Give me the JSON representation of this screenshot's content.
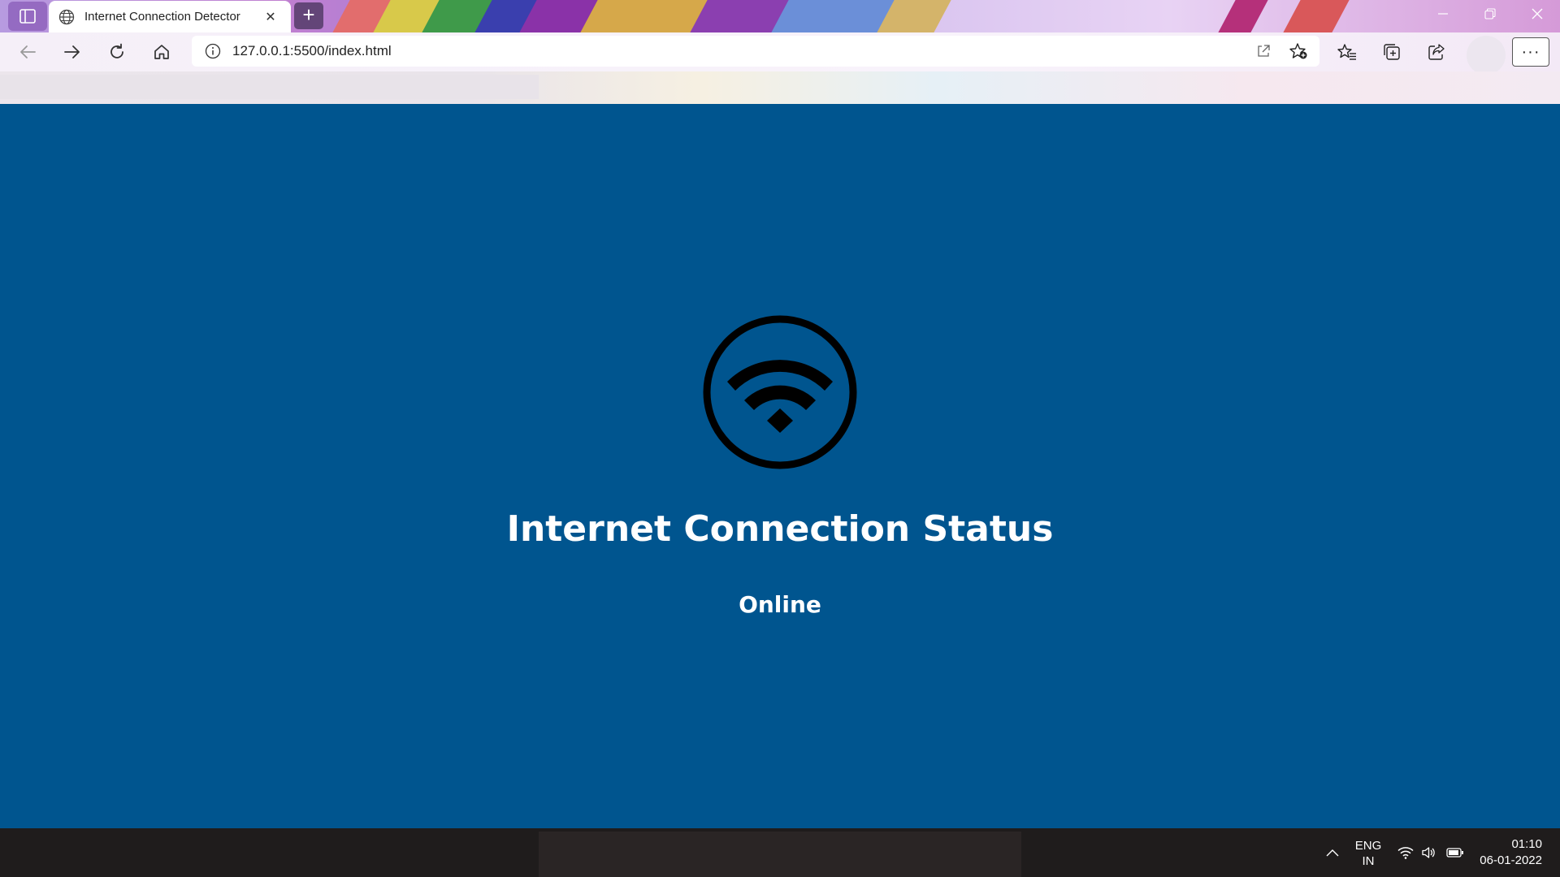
{
  "browser": {
    "tab": {
      "title": "Internet Connection Detector",
      "favicon": "globe-icon",
      "close_glyph": "✕"
    },
    "new_tab_glyph": "+",
    "address_bar": {
      "url": "127.0.0.1:5500/index.html",
      "info_icon": "info-icon"
    },
    "more_glyph": "···"
  },
  "page": {
    "icon": "wifi-icon",
    "heading": "Internet Connection Status",
    "status": "Online",
    "colors": {
      "background": "#00558f",
      "text": "#ffffff",
      "icon": "#000000"
    }
  },
  "taskbar": {
    "language_line1": "ENG",
    "language_line2": "IN",
    "time": "01:10",
    "date": "06-01-2022"
  }
}
